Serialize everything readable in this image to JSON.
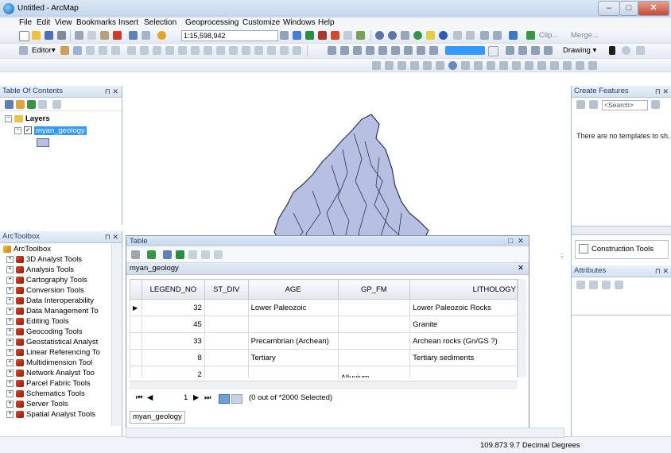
{
  "window": {
    "title": "Untitled - ArcMap",
    "minimize": "–",
    "maximize": "□",
    "close": "✕"
  },
  "menu": [
    "File",
    "Edit",
    "View",
    "Bookmarks",
    "Insert",
    "Selection",
    "Geoprocessing",
    "Customize",
    "Windows",
    "Help"
  ],
  "toolbar": {
    "scale": "1:15,598,942",
    "editor_label": "Editor▾",
    "drawing_label": "Drawing ▾",
    "clip_label": "Clip...",
    "merge_label": "Merge..."
  },
  "toc": {
    "title": "Table Of Contents",
    "root": "Layers",
    "layer": "myan_geology"
  },
  "toolbox": {
    "title": "ArcToolbox",
    "root": "ArcToolbox",
    "items": [
      "3D Analyst Tools",
      "Analysis Tools",
      "Cartography Tools",
      "Conversion Tools",
      "Data Interoperability",
      "Data Management To",
      "Editing Tools",
      "Geocoding Tools",
      "Geostatistical Analyst",
      "Linear Referencing To",
      "Multidimension Tool",
      "Network Analyst Too",
      "Parcel Fabric Tools",
      "Schematics Tools",
      "Server Tools",
      "Spatial Analyst Tools"
    ]
  },
  "create_features": {
    "title": "Create Features",
    "search_placeholder": "<Search>",
    "message": "There are no templates to sh..."
  },
  "construction_tools": {
    "title": "Construction Tools"
  },
  "attributes": {
    "title": "Attributes"
  },
  "table": {
    "window_title": "Table",
    "layer_tab": "myan_geology",
    "columns": [
      "LEGEND_NO",
      "ST_DIV",
      "AGE",
      "GP_FM",
      "LITHOLOGY"
    ],
    "rows": [
      [
        "32",
        "",
        "Lower Paleozoic",
        "",
        "Lower Paleozoic Rocks"
      ],
      [
        "45",
        "",
        "",
        "",
        "Granite"
      ],
      [
        "33",
        "",
        "Precambrian (Archean)",
        "",
        "Archean rocks (Gn/GS ?)"
      ],
      [
        "8",
        "",
        "Tertiary",
        "",
        "Tertiary sediments"
      ],
      [
        "2",
        "",
        "",
        "Alluvium",
        ""
      ]
    ],
    "record": "1",
    "selection_status": "(0 out of *2000 Selected)",
    "bottom_tab": "myan_geology"
  },
  "status": {
    "coordinates": "109.873  9.7 Decimal Degrees"
  },
  "colors": {
    "map_fill": "#b7bfe3",
    "map_stroke": "#303648",
    "accent": "#3399ff"
  }
}
